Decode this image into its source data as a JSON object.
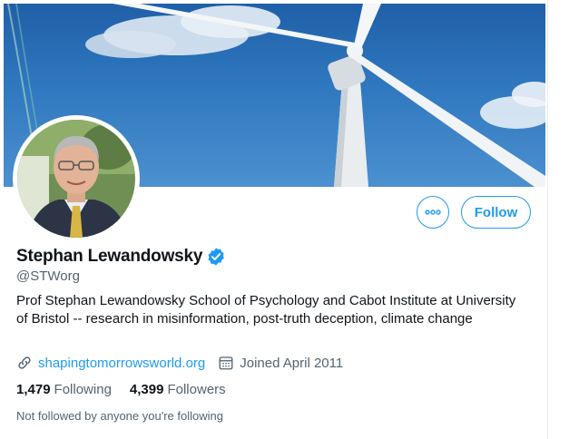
{
  "profile": {
    "name": "Stephan Lewandowsky",
    "handle": "@STWorg",
    "bio": "Prof Stephan Lewandowsky School of Psychology and Cabot Institute at University of Bristol -- research in misinformation, post-truth deception, climate change",
    "website": "shapingtomorrowsworld.org",
    "joined": "Joined April 2011",
    "verified_icon": "verified-badge-icon"
  },
  "actions": {
    "follow_label": "Follow",
    "more_icon": "more-options-icon"
  },
  "stats": {
    "following_count": "1,479",
    "following_label": "Following",
    "followers_count": "4,399",
    "followers_label": "Followers"
  },
  "followed_by_note": "Not followed by anyone you're following",
  "colors": {
    "accent": "#1d9bf0",
    "text_primary": "#0f1419",
    "text_secondary": "#536471"
  },
  "banner_image": "wind-turbine-against-blue-sky",
  "avatar_image": "man-in-suit-with-yellow-tie"
}
